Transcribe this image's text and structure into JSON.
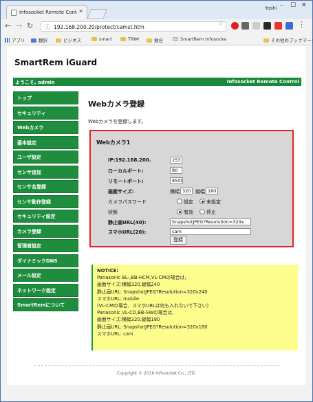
{
  "browser": {
    "tab_title": "Infosocket Remote Contr",
    "user": "Yoshi",
    "url": "192.168.200.20/protect/camst.htm",
    "bookmarks": [
      "アプリ",
      "翻訳",
      "ビジネス",
      "smart",
      "TRIM",
      "競合",
      "SmartRem Infosocke",
      "その他のブックマーク"
    ]
  },
  "site": {
    "logo": "SmartRem iGuard",
    "welcome": "ようこそ, admin",
    "brand": "Infosocket Remote Control"
  },
  "sidebar": {
    "items": [
      "トップ",
      "セキュリティ",
      "Webカメラ",
      "基本設定",
      "ユーザ設定",
      "センサ追加",
      "センサ名登録",
      "センサ動作登録",
      "セキュリティ設定",
      "カメラ登録",
      "管理者設定",
      "ダイナミックDNS",
      "メール設定",
      "ネットワーク設定",
      "SmartRemについて"
    ]
  },
  "main": {
    "title": "Webカメラ登録",
    "lead": "Webカメラを登録します。",
    "camera": {
      "heading": "Webカメラ1",
      "ip_label": "IP:192.168.200.",
      "ip_value": "253",
      "local_port_label": "ローカルポート:",
      "local_port_value": "80",
      "remote_port_label": "リモートポート:",
      "remote_port_value": "8500",
      "screen_size_label": "画面サイズ:",
      "width_label": "横幅",
      "width_value": "320",
      "height_label": "縦幅",
      "height_value": "180",
      "password_label": "カメラパスワード",
      "password_set": "設定",
      "password_unset": "未設定",
      "state_label": "状態",
      "state_on": "有効",
      "state_off": "停止",
      "still_url_label": "静止画URL(40):",
      "still_url_value": "SnapshotJPEG?Resolution=320x",
      "mobile_url_label": "スマホURL(20):",
      "mobile_url_value": "cam",
      "submit": "登録"
    }
  },
  "notice": {
    "lines": [
      "NOTICE:",
      "Panasonic BL-,BB-HCM,VL-CMの場合は,",
      "画面サイズ:横幅320,縦幅240",
      "静止画URL: SnapshotJPEG?Resolution=320x240",
      "スマホURL: mobile",
      "(VL-CMの場合、スマホURLは何も入れないで下さい)",
      "Panasonic VL-CD,BB-SWの場合は,",
      "画面サイズ:横幅320,縦幅180",
      "静止画URL: SnapshotJPEG?Resolution=320x180",
      "スマホURL: cam"
    ]
  },
  "footer": {
    "copyright": "Copyright © 2016 Infosocket Co., LTD."
  },
  "colors": {
    "accent_green": "#18893a",
    "highlight_red": "#e52222",
    "notice_yellow": "#fdfd8e"
  }
}
